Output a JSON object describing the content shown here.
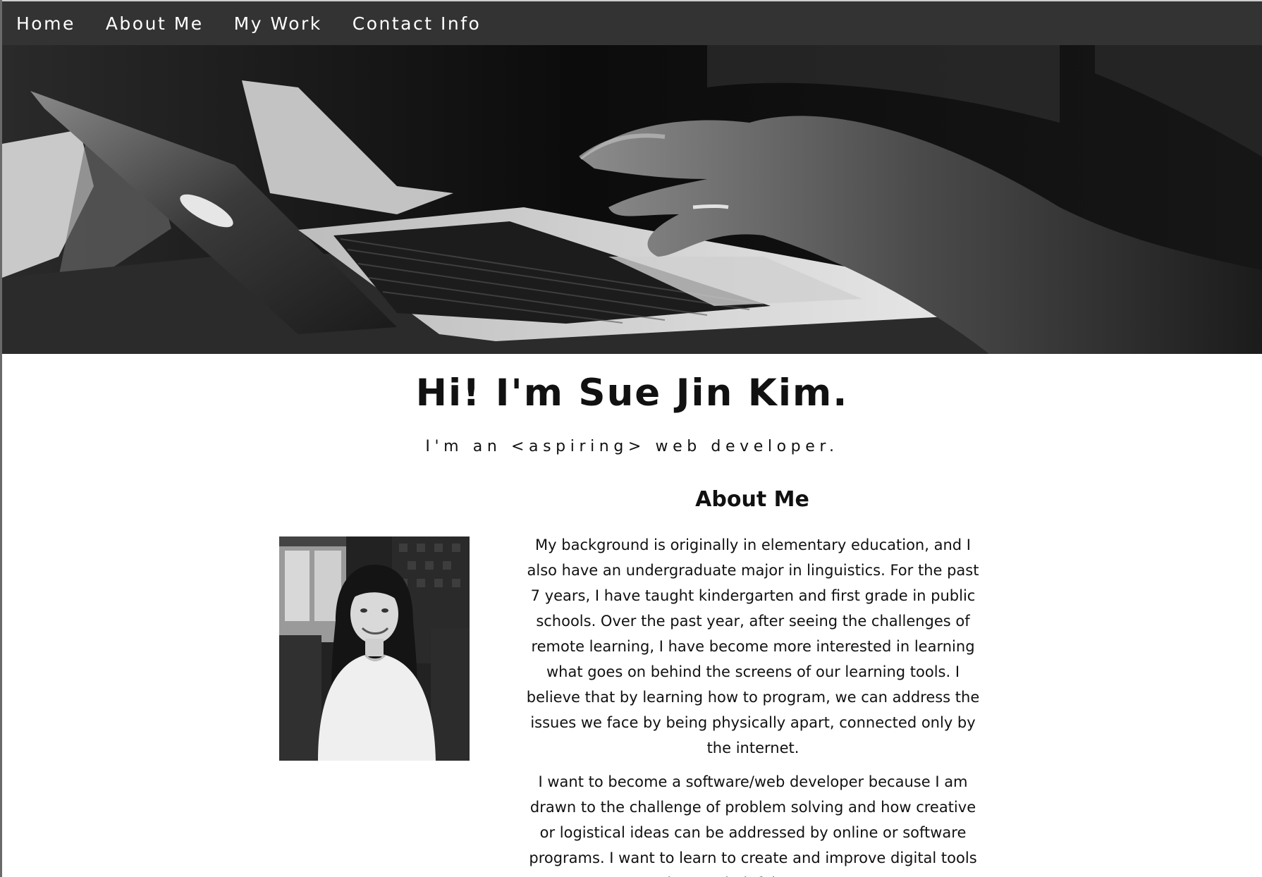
{
  "nav": {
    "items": [
      {
        "label": "Home"
      },
      {
        "label": "About Me"
      },
      {
        "label": "My Work"
      },
      {
        "label": "Contact Info"
      }
    ]
  },
  "hero": {
    "image": "laptop-typing-photo"
  },
  "intro": {
    "title": "Hi! I'm Sue Jin Kim.",
    "subtitle": "I'm an <aspiring> web developer."
  },
  "about": {
    "heading": "About Me",
    "photo": "profile-photo",
    "paragraph1": "My background is originally in elementary education, and I also have an undergraduate major in linguistics. For the past 7 years, I have taught kindergarten and first grade in public schools. Over the past year, after seeing the challenges of remote learning, I have become more interested in learning what goes on behind the screens of our learning tools. I believe that by learning how to program, we can address the issues we face by being physically apart, connected only by the internet.",
    "paragraph2": "I want to become a software/web developer because I am drawn to the challenge of problem solving and how creative or logistical ideas can be addressed by online or software programs. I want to learn to create and improve digital tools that are helpful to users."
  },
  "colors": {
    "nav_background": "#333333",
    "nav_text": "#ffffff",
    "page_background": "#ffffff",
    "text": "#111111"
  }
}
